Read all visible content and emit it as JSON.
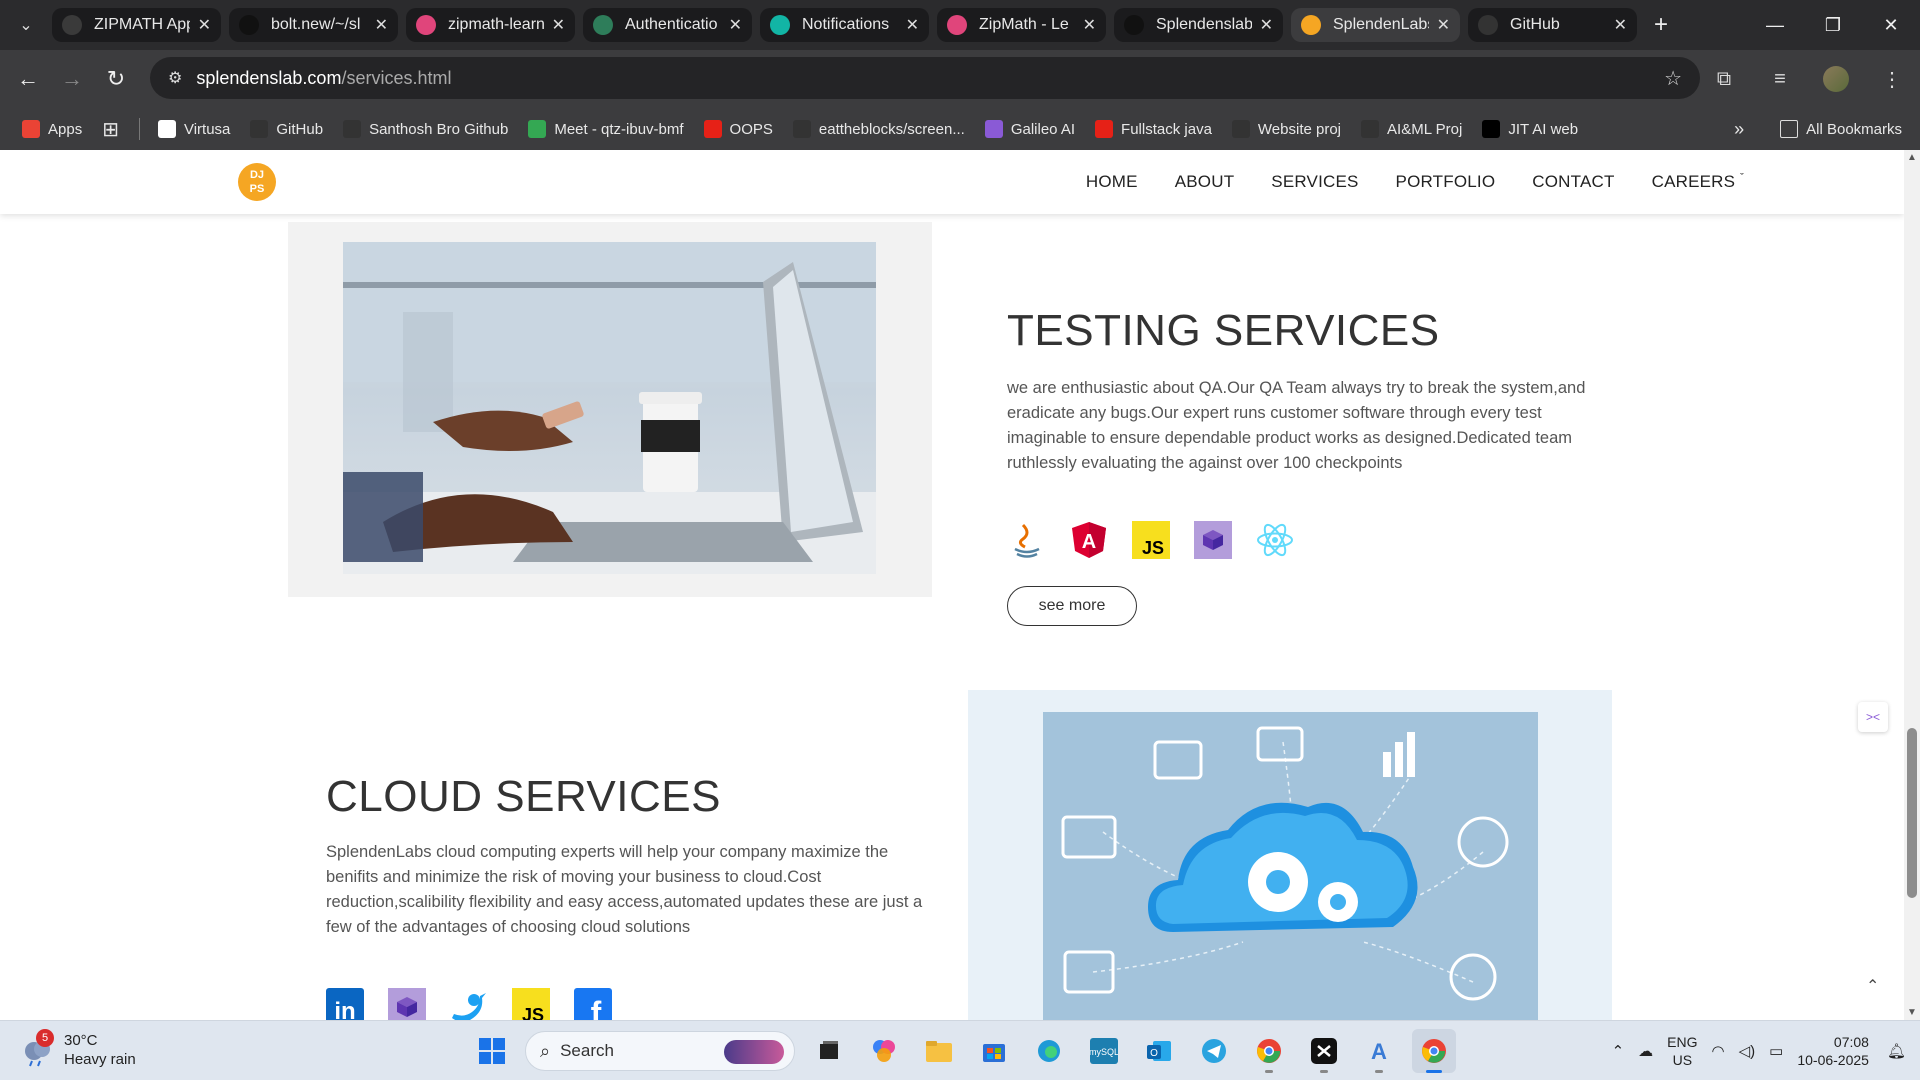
{
  "browser": {
    "tabs": [
      {
        "title": "ZIPMATH App",
        "color": "#3a3a3a",
        "active": false
      },
      {
        "title": "bolt.new/~/sl",
        "color": "#111111",
        "active": false
      },
      {
        "title": "zipmath-learn",
        "color": "#e0457b",
        "active": false
      },
      {
        "title": "Authenticatio",
        "color": "#2e7d5a",
        "active": false
      },
      {
        "title": "Notifications",
        "color": "#12b5a5",
        "active": false
      },
      {
        "title": "ZipMath - Le",
        "color": "#e0457b",
        "active": false
      },
      {
        "title": "Splendenslab",
        "color": "#111111",
        "active": false
      },
      {
        "title": "SplendenLabs",
        "color": "#f5a623",
        "active": true
      },
      {
        "title": "GitHub",
        "color": "#333333",
        "active": false
      }
    ],
    "url_host": "splendenslab.com",
    "url_path": "/services.html",
    "bookmarks": [
      {
        "label": "Apps",
        "color": "#ea4335"
      },
      {
        "label": "Virtusa",
        "color": "#ffffff"
      },
      {
        "label": "GitHub",
        "color": "#333333"
      },
      {
        "label": "Santhosh Bro Github",
        "color": "#333333"
      },
      {
        "label": "Meet - qtz-ibuv-bmf",
        "color": "#34a853"
      },
      {
        "label": "OOPS",
        "color": "#e62117"
      },
      {
        "label": "eattheblocks/screen...",
        "color": "#333333"
      },
      {
        "label": "Galileo AI",
        "color": "#8a5ad6"
      },
      {
        "label": "Fullstack java",
        "color": "#e62117"
      },
      {
        "label": "Website proj",
        "color": "#333333"
      },
      {
        "label": "AI&ML Proj",
        "color": "#333333"
      },
      {
        "label": "JIT AI web",
        "color": "#000000"
      }
    ],
    "all_bookmarks": "All Bookmarks"
  },
  "site": {
    "nav": [
      "HOME",
      "ABOUT",
      "SERVICES",
      "PORTFOLIO",
      "CONTACT",
      "CAREERS"
    ],
    "logo_top": "DJ",
    "logo_bottom": "PS",
    "testing": {
      "title": "TESTING SERVICES",
      "body": "we are enthusiastic about QA.Our QA Team always try to break the system,and eradicate any bugs.Our expert runs customer software through every test imaginable to ensure dependable product works as designed.Dedicated team ruthlessly evaluating the against over 100 checkpoints",
      "icons": [
        "java-icon",
        "angular-icon",
        "javascript-icon",
        "cube-icon",
        "react-icon"
      ],
      "button": "see more"
    },
    "cloud": {
      "title": "CLOUD SERVICES",
      "body": "SplendenLabs cloud computing experts will help your company maximize the benifits and minimize the risk of moving your business to cloud.Cost reduction,scalibility flexibility and easy access,automated updates these are just a few of the advantages of choosing cloud solutions",
      "icons": [
        "linkedin-icon",
        "cube-icon",
        "twitter-icon",
        "javascript-icon",
        "facebook-icon"
      ]
    }
  },
  "taskbar": {
    "weather_temp": "30°C",
    "weather_desc": "Heavy rain",
    "weather_badge": "5",
    "search": "Search",
    "lang_top": "ENG",
    "lang_bottom": "US",
    "time": "07:08",
    "date": "10-06-2025"
  }
}
